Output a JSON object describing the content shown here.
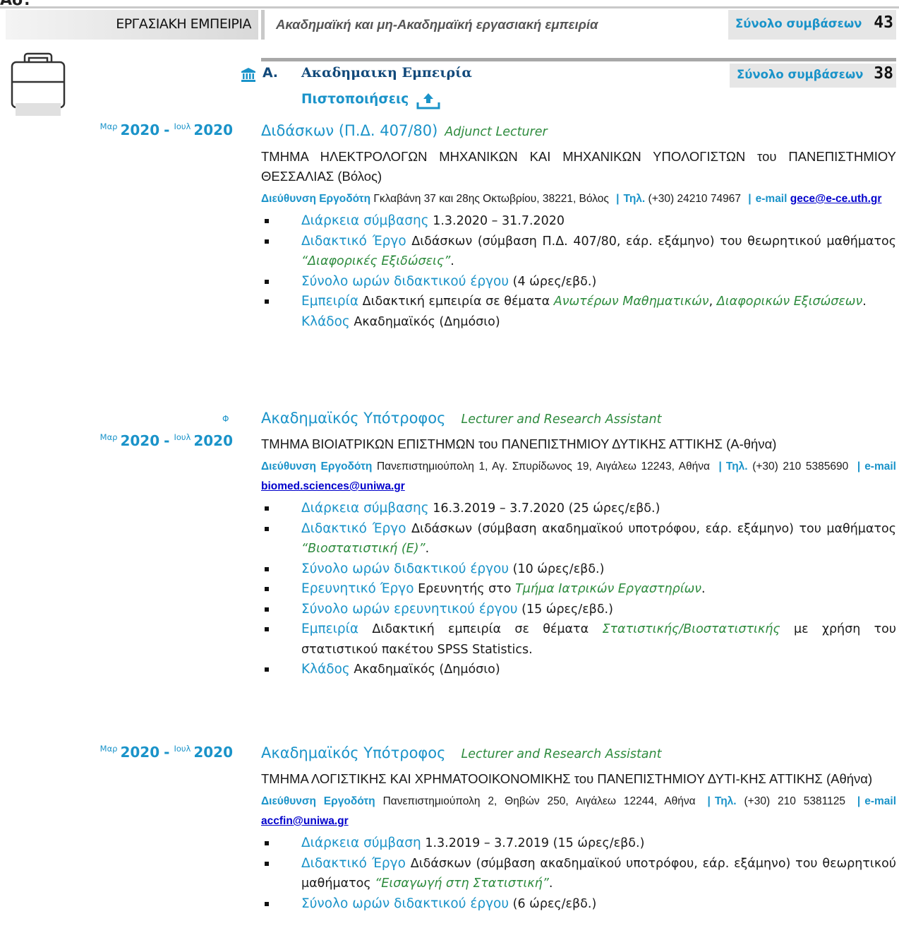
{
  "header": {
    "top_cut_text": "Ασ.",
    "section": "ΕΡΓΑΣΙΑΚΗ ΕΜΠΕΙΡΙΑ",
    "subtitle": "Ακαδημαϊκή και μη-Ακαδημαϊκή εργασιακή εμπειρία",
    "total_label": "Σύνολο συμβάσεων",
    "total_value": "43"
  },
  "subsection": {
    "letter": "Α.",
    "title": "Ακαδημαικη Εμπειρία",
    "total_label": "Σύνολο συμβάσεων",
    "total_value": "38",
    "certificates": "Πιστοποιήσεις"
  },
  "entries": [
    {
      "from_month": "Μαρ",
      "from_year": "2020",
      "dash": "-",
      "to_month": "Ιουλ",
      "to_year": "2020",
      "title": "Διδάσκων (Π.Δ. 407/80)",
      "title_en": "Adjunct Lecturer",
      "department": "ΤΜΗΜΑ ΗΛΕΚΤΡΟΛΟΓΩΝ ΜΗΧΑΝΙΚΩΝ ΚΑΙ ΜΗΧΑΝΙΚΩΝ ΥΠΟΛΟΓΙΣΤΩΝ του ΠΑΝΕΠΙΣΤΗΜΙΟΥ ΘΕΣΣΑΛΙΑΣ (Βόλος)",
      "address_label": "Διεύθυνση Εργοδότη",
      "address": "Γκλαβάνη 37 και 28ης Οκτωβρίου, 38221, Βόλος",
      "phone_label": "Τηλ.",
      "phone": "(+30) 24210 74967",
      "email_label": "e-mail",
      "email": "gece@e-ce.uth.gr",
      "items": [
        {
          "key": "Διάρκεια σύμβασης",
          "text": "1.3.2020 – 31.7.2020"
        },
        {
          "key": "Διδακτικό Έργο",
          "text": "Διδάσκων (σύμβαση Π.Δ. 407/80, εάρ. εξάμηνο) του θεωρητικού μαθήματος",
          "em": "“Διαφορικές Εξιδώσεις”",
          "tail": "."
        },
        {
          "key": "Σύνολο ωρών διδακτικού έργου",
          "text": "(4 ώρες/εβδ.)"
        },
        {
          "key": "Εμπειρία",
          "text": "Διδακτική εμπειρία σε θέματα",
          "em": "Ανωτέρων Μαθηματικών",
          "mid": ",",
          "em2": "Διαφορικών Εξισώσεων",
          "tail": "."
        },
        {
          "key": "Κλάδος",
          "text": "Ακαδημαϊκός (Δημόσιο)"
        }
      ]
    },
    {
      "marker": "Φ",
      "from_month": "Μαρ",
      "from_year": "2020",
      "dash": "-",
      "to_month": "Ιουλ",
      "to_year": "2020",
      "title": "Ακαδημαϊκός Υπότροφος",
      "title_en": "Lecturer and Research Assistant",
      "department": "ΤΜΗΜΑ ΒΙΟΙΑΤΡΙΚΩΝ ΕΠΙΣΤΗΜΩΝ του ΠΑΝΕΠΙΣΤΗΜΙΟΥ ΔΥΤΙΚΗΣ ΑΤΤΙΚΗΣ (Α-θήνα)",
      "address_label": "Διεύθυνση Εργοδότη",
      "address": "Πανεπιστημιούπολη 1, Αγ. Σπυρίδωνος 19, Αιγάλεω 12243, Αθήνα",
      "phone_label": "Τηλ.",
      "phone": "(+30) 210 5385690",
      "email_label": "e-mail",
      "email": "biomed.sciences@uniwa.gr",
      "items": [
        {
          "key": "Διάρκεια σύμβασης",
          "text": "16.3.2019 – 3.7.2020 (25 ώρες/εβδ.)"
        },
        {
          "key": "Διδακτικό Έργο",
          "text": "Διδάσκων (σύμβαση ακαδημαϊκού υποτρόφου, εάρ. εξάμηνο) του μαθήματος",
          "em": "“Βιοστατιστική (Ε)”",
          "tail": "."
        },
        {
          "key": "Σύνολο ωρών διδακτικού έργου",
          "text": "(10 ώρες/εβδ.)"
        },
        {
          "key": "Ερευνητικό Έργο",
          "text": "Ερευνητής στο",
          "em": "Τμήμα Ιατρικών Εργαστηρίων",
          "tail": "."
        },
        {
          "key": "Σύνολο ωρών ερευνητικού έργου",
          "text": "(15 ώρες/εβδ.)"
        },
        {
          "key": "Εμπειρία",
          "text": "Διδακτική εμπειρία σε θέματα",
          "em": "Στατιστικής/Βιοστατιστικής",
          "tail": "με χρήση του στατιστικού πακέτου SPSS Statistics."
        },
        {
          "key": "Κλάδος",
          "text": "Ακαδημαϊκός (Δημόσιο)"
        }
      ]
    },
    {
      "from_month": "Μαρ",
      "from_year": "2020",
      "dash": "-",
      "to_month": "Ιουλ",
      "to_year": "2020",
      "title": "Ακαδημαϊκός Υπότροφος",
      "title_en": "Lecturer and Research Assistant",
      "department": "ΤΜΗΜΑ ΛΟΓΙΣΤΙΚΗΣ ΚΑΙ ΧΡΗΜΑΤΟΟΙΚΟΝΟΜΙΚΗΣ του ΠΑΝΕΠΙΣΤΗΜΙΟΥ ΔΥΤΙ-ΚΗΣ ΑΤΤΙΚΗΣ (Αθήνα)",
      "address_label": "Διεύθυνση Εργοδότη",
      "address": "Πανεπιστημιούπολη 2, Θηβών 250, Αιγάλεω 12244, Αθήνα",
      "phone_label": "Τηλ.",
      "phone": "(+30) 210 5381125",
      "email_label": "e-mail",
      "email": "accfin@uniwa.gr",
      "items": [
        {
          "key": "Διάρκεια σύμβαση",
          "text": "1.3.2019 – 3.7.2019 (15 ώρες/εβδ.)"
        },
        {
          "key": "Διδακτικό Έργο",
          "text": "Διδάσκων (σύμβαση ακαδημαϊκού υποτρόφου, εάρ. εξάμηνο) του θεωρητικού μαθήματος",
          "em": "“Εισαγωγή στη Στατιστική”",
          "tail": "."
        },
        {
          "key": "Σύνολο ωρών διδακτικού έργου",
          "text": "(6 ώρες/εβδ.)"
        }
      ]
    }
  ],
  "colors": {
    "accent": "#1a93c9",
    "heading": "#11497a",
    "italic": "#2e8b3e",
    "link": "#0000cc"
  },
  "icons": [
    "briefcase-icon",
    "academy-icon",
    "upload-icon"
  ]
}
